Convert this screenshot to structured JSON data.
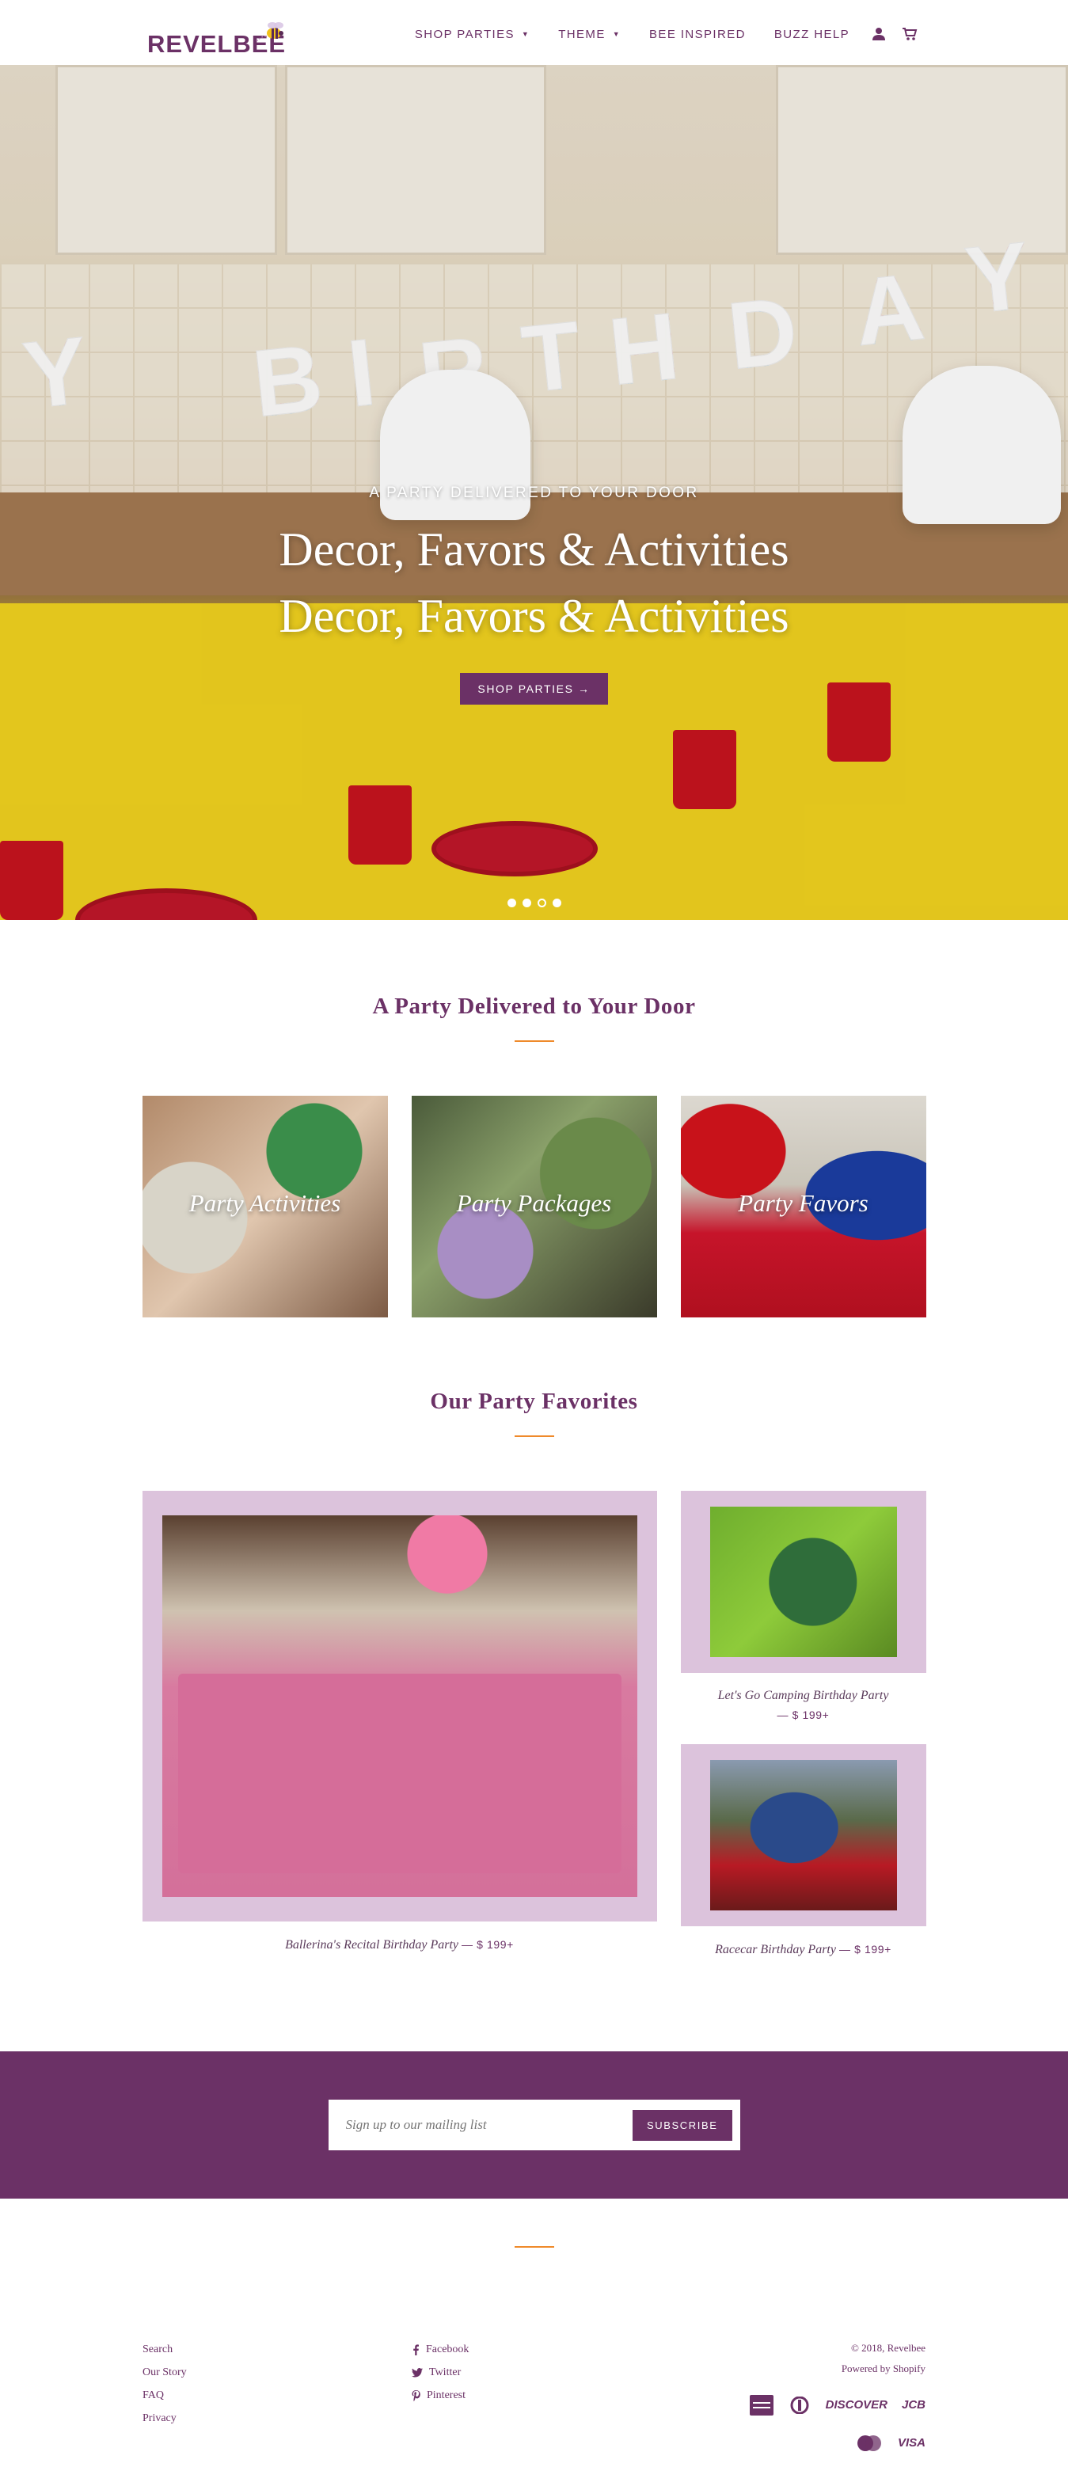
{
  "brand": {
    "name": "REVELBEE",
    "color": "#6b3166",
    "accent": "#ef8a2b",
    "frame_color": "#dcc3dc"
  },
  "nav": {
    "items": [
      {
        "label": "SHOP PARTIES",
        "dropdown": true
      },
      {
        "label": "THEME",
        "dropdown": true
      },
      {
        "label": "BEE INSPIRED",
        "dropdown": false
      },
      {
        "label": "BUZZ HELP",
        "dropdown": false
      }
    ],
    "icons": [
      "user-icon",
      "cart-icon"
    ]
  },
  "hero": {
    "subtitle": "A PARTY DELIVERED TO YOUR DOOR",
    "title": "Decor, Favors & Activities",
    "button_label": "SHOP PARTIES →",
    "slides": 4,
    "active_slide": 3,
    "banner_letters": [
      "Y",
      "B",
      "I",
      "R",
      "T",
      "H",
      "D",
      "A",
      "Y"
    ]
  },
  "section_delivered": {
    "title": "A Party Delivered to Your Door",
    "tiles": [
      {
        "label": "Party Activities"
      },
      {
        "label": "Party Packages"
      },
      {
        "label": "Party Favors"
      }
    ]
  },
  "section_favorites": {
    "title": "Our Party Favorites",
    "featured": {
      "name": "Ballerina's Recital Birthday Party",
      "price": "$ 199+"
    },
    "side": [
      {
        "name": "Let's Go Camping Birthday Party",
        "price": "$ 199+"
      },
      {
        "name": "Racecar Birthday Party",
        "price": "$ 199+"
      }
    ]
  },
  "newsletter": {
    "placeholder": "Sign up to our mailing list",
    "button_label": "SUBSCRIBE"
  },
  "footer": {
    "links": [
      "Search",
      "Our Story",
      "FAQ",
      "Privacy"
    ],
    "social": [
      {
        "label": "Facebook",
        "icon": "facebook-icon"
      },
      {
        "label": "Twitter",
        "icon": "twitter-icon"
      },
      {
        "label": "Pinterest",
        "icon": "pinterest-icon"
      }
    ],
    "copyright": "© 2018, Revelbee",
    "powered": "Powered by Shopify",
    "payments": [
      "american-express-icon",
      "diners-club-icon",
      "DISCOVER",
      "JCB",
      "mastercard-icon",
      "VISA"
    ]
  }
}
